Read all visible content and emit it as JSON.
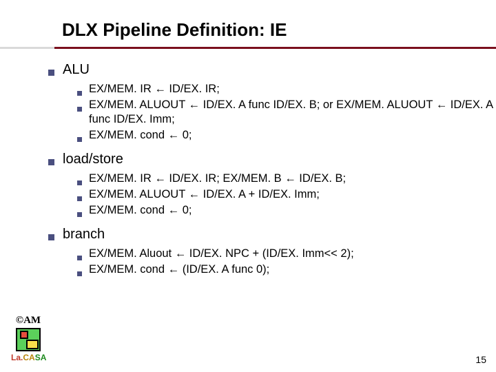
{
  "title": "DLX Pipeline Definition: IE",
  "sections": [
    {
      "heading": "ALU",
      "items": [
        "EX/MEM. IR ← ID/EX. IR;",
        "EX/MEM. ALUOUT ← ID/EX. A func ID/EX. B; or EX/MEM. ALUOUT ← ID/EX. A func ID/EX. Imm;",
        "EX/MEM. cond ← 0;"
      ]
    },
    {
      "heading": "load/store",
      "items": [
        "EX/MEM. IR ← ID/EX. IR; EX/MEM. B ← ID/EX. B;",
        "EX/MEM. ALUOUT ← ID/EX. A + ID/EX. Imm;",
        "EX/MEM. cond ← 0;"
      ]
    },
    {
      "heading": "branch",
      "items": [
        "EX/MEM. Aluout ← ID/EX. NPC + (ID/EX. Imm<< 2);",
        "EX/MEM. cond ← (ID/EX. A func 0);"
      ]
    }
  ],
  "logo": {
    "copyright": "©AM",
    "label_parts": {
      "la": "La.",
      "ca": "CA",
      "sa": "SA"
    }
  },
  "page_number": "15"
}
